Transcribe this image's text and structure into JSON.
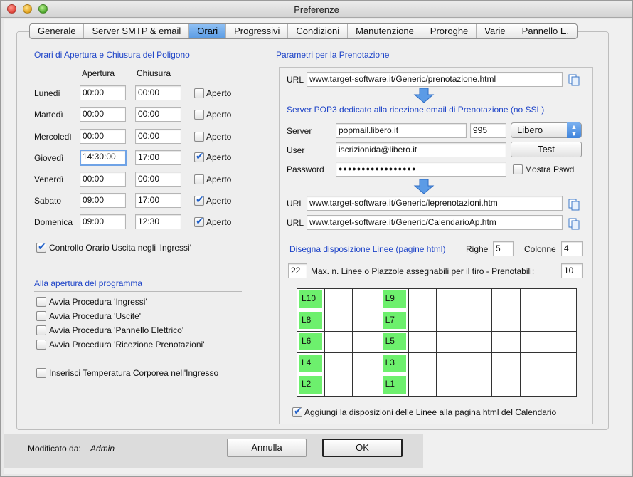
{
  "window": {
    "title": "Preferenze"
  },
  "tabs": [
    {
      "label": "Generale"
    },
    {
      "label": "Server SMTP & email"
    },
    {
      "label": "Orari",
      "active": true
    },
    {
      "label": "Progressivi"
    },
    {
      "label": "Condizioni"
    },
    {
      "label": "Manutenzione"
    },
    {
      "label": "Proroghe"
    },
    {
      "label": "Varie"
    },
    {
      "label": "Pannello E."
    }
  ],
  "hours": {
    "section_title": "Orari di Apertura e Chiusura del Poligono",
    "col_open": "Apertura",
    "col_close": "Chiusura",
    "days": [
      {
        "day": "Lunedì",
        "open": "00:00",
        "close": "00:00",
        "aperto_label": "Aperto",
        "aperto": false
      },
      {
        "day": "Martedì",
        "open": "00:00",
        "close": "00:00",
        "aperto_label": "Aperto",
        "aperto": false
      },
      {
        "day": "Mercoledì",
        "open": "00:00",
        "close": "00:00",
        "aperto_label": "Aperto",
        "aperto": false
      },
      {
        "day": "Giovedì",
        "open": "14:30:00",
        "close": "17:00",
        "aperto_label": "Aperto",
        "aperto": true
      },
      {
        "day": "Venerdì",
        "open": "00:00",
        "close": "00:00",
        "aperto_label": "Aperto",
        "aperto": false
      },
      {
        "day": "Sabato",
        "open": "09:00",
        "close": "17:00",
        "aperto_label": "Aperto",
        "aperto": true
      },
      {
        "day": "Domenica",
        "open": "09:00",
        "close": "12:30",
        "aperto_label": "Aperto",
        "aperto": true
      }
    ],
    "controllo_label": "Controllo Orario Uscita negli 'Ingressi'",
    "controllo_checked": true
  },
  "startup": {
    "section_title": "Alla apertura del programma",
    "items": [
      {
        "label": "Avvia Procedura 'Ingressi'",
        "checked": false
      },
      {
        "label": "Avvia Procedura 'Uscite'",
        "checked": false
      },
      {
        "label": "Avvia Procedura 'Pannello Elettrico'",
        "checked": false
      },
      {
        "label": "Avvia Procedura 'Ricezione Prenotazioni'",
        "checked": false
      }
    ],
    "temperature_label": "Inserisci Temperatura Corporea nell'Ingresso",
    "temperature_checked": false
  },
  "booking": {
    "section_title": "Parametri per la Prenotazione",
    "url_label": "URL",
    "url1": "www.target-software.it/Generic/prenotazione.html",
    "pop3_title": "Server POP3 dedicato alla ricezione email di Prenotazione (no SSL)",
    "server_label": "Server",
    "server_value": "popmail.libero.it",
    "port_value": "995",
    "provider_value": "Libero",
    "user_label": "User",
    "user_value": "iscrizionida@libero.it",
    "test_label": "Test",
    "password_label": "Password",
    "password_value": "●●●●●●●●●●●●●●●●●",
    "show_pwd_label": "Mostra Pswd",
    "show_pwd_checked": false,
    "url2": "www.target-software.it/Generic/leprenotazioni.htm",
    "url3": "www.target-software.it/Generic/CalendarioAp.htm",
    "layout_title": "Disegna disposizione Linee (pagine html)",
    "righe_label": "Righe",
    "righe_value": "5",
    "colonne_label": "Colonne",
    "colonne_value": "4",
    "max_value": "22",
    "max_label": "Max. n. Linee o Piazzole assegnabili per il tiro  -  Prenotabili:",
    "prenotabili_value": "10",
    "lanes": [
      "L10",
      "L9",
      "L8",
      "L7",
      "L6",
      "L5",
      "L4",
      "L3",
      "L2",
      "L1"
    ],
    "lane_color": "#6df06d",
    "add_layout_label": "Aggiungi la disposizioni delle Linee alla pagina html del Calendario",
    "add_layout_checked": true
  },
  "footer": {
    "modified_label": "Modificato da:",
    "modified_value": "Admin",
    "cancel_label": "Annulla",
    "ok_label": "OK"
  }
}
